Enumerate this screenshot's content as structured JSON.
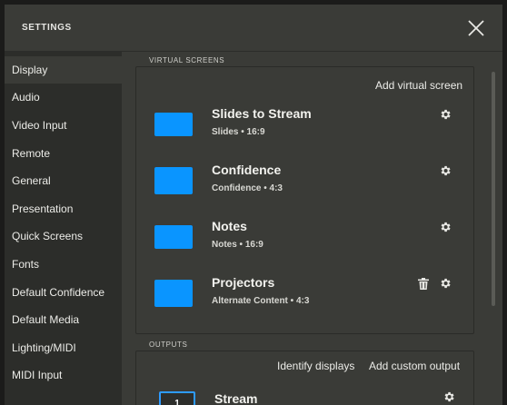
{
  "window": {
    "title": "SETTINGS"
  },
  "sidebar": {
    "items": [
      {
        "label": "Display",
        "active": true
      },
      {
        "label": "Audio"
      },
      {
        "label": "Video Input"
      },
      {
        "label": "Remote"
      },
      {
        "label": "General"
      },
      {
        "label": "Presentation"
      },
      {
        "label": "Quick Screens"
      },
      {
        "label": "Fonts"
      },
      {
        "label": "Default Confidence"
      },
      {
        "label": "Default Media"
      },
      {
        "label": "Lighting/MIDI"
      },
      {
        "label": "MIDI Input"
      }
    ]
  },
  "virtual_screens": {
    "section_label": "VIRTUAL SCREENS",
    "add_label": "Add virtual screen",
    "thumb_color": "#0a95ff",
    "screens": [
      {
        "name": "Slides to Stream",
        "subtitle": "Slides • 16:9",
        "icons": [
          "gear-icon"
        ]
      },
      {
        "name": "Confidence",
        "subtitle": "Confidence • 4:3",
        "icons": [
          "gear-icon"
        ]
      },
      {
        "name": "Notes",
        "subtitle": "Notes • 16:9",
        "icons": [
          "gear-icon"
        ]
      },
      {
        "name": "Projectors",
        "subtitle": "Alternate Content • 4:3",
        "icons": [
          "trash-icon",
          "gear-icon"
        ]
      }
    ]
  },
  "outputs": {
    "section_label": "OUTPUTS",
    "identify_label": "Identify displays",
    "add_label": "Add custom output",
    "items": [
      {
        "number": "1",
        "name": "Stream",
        "icons": [
          "gear-icon"
        ]
      }
    ]
  }
}
